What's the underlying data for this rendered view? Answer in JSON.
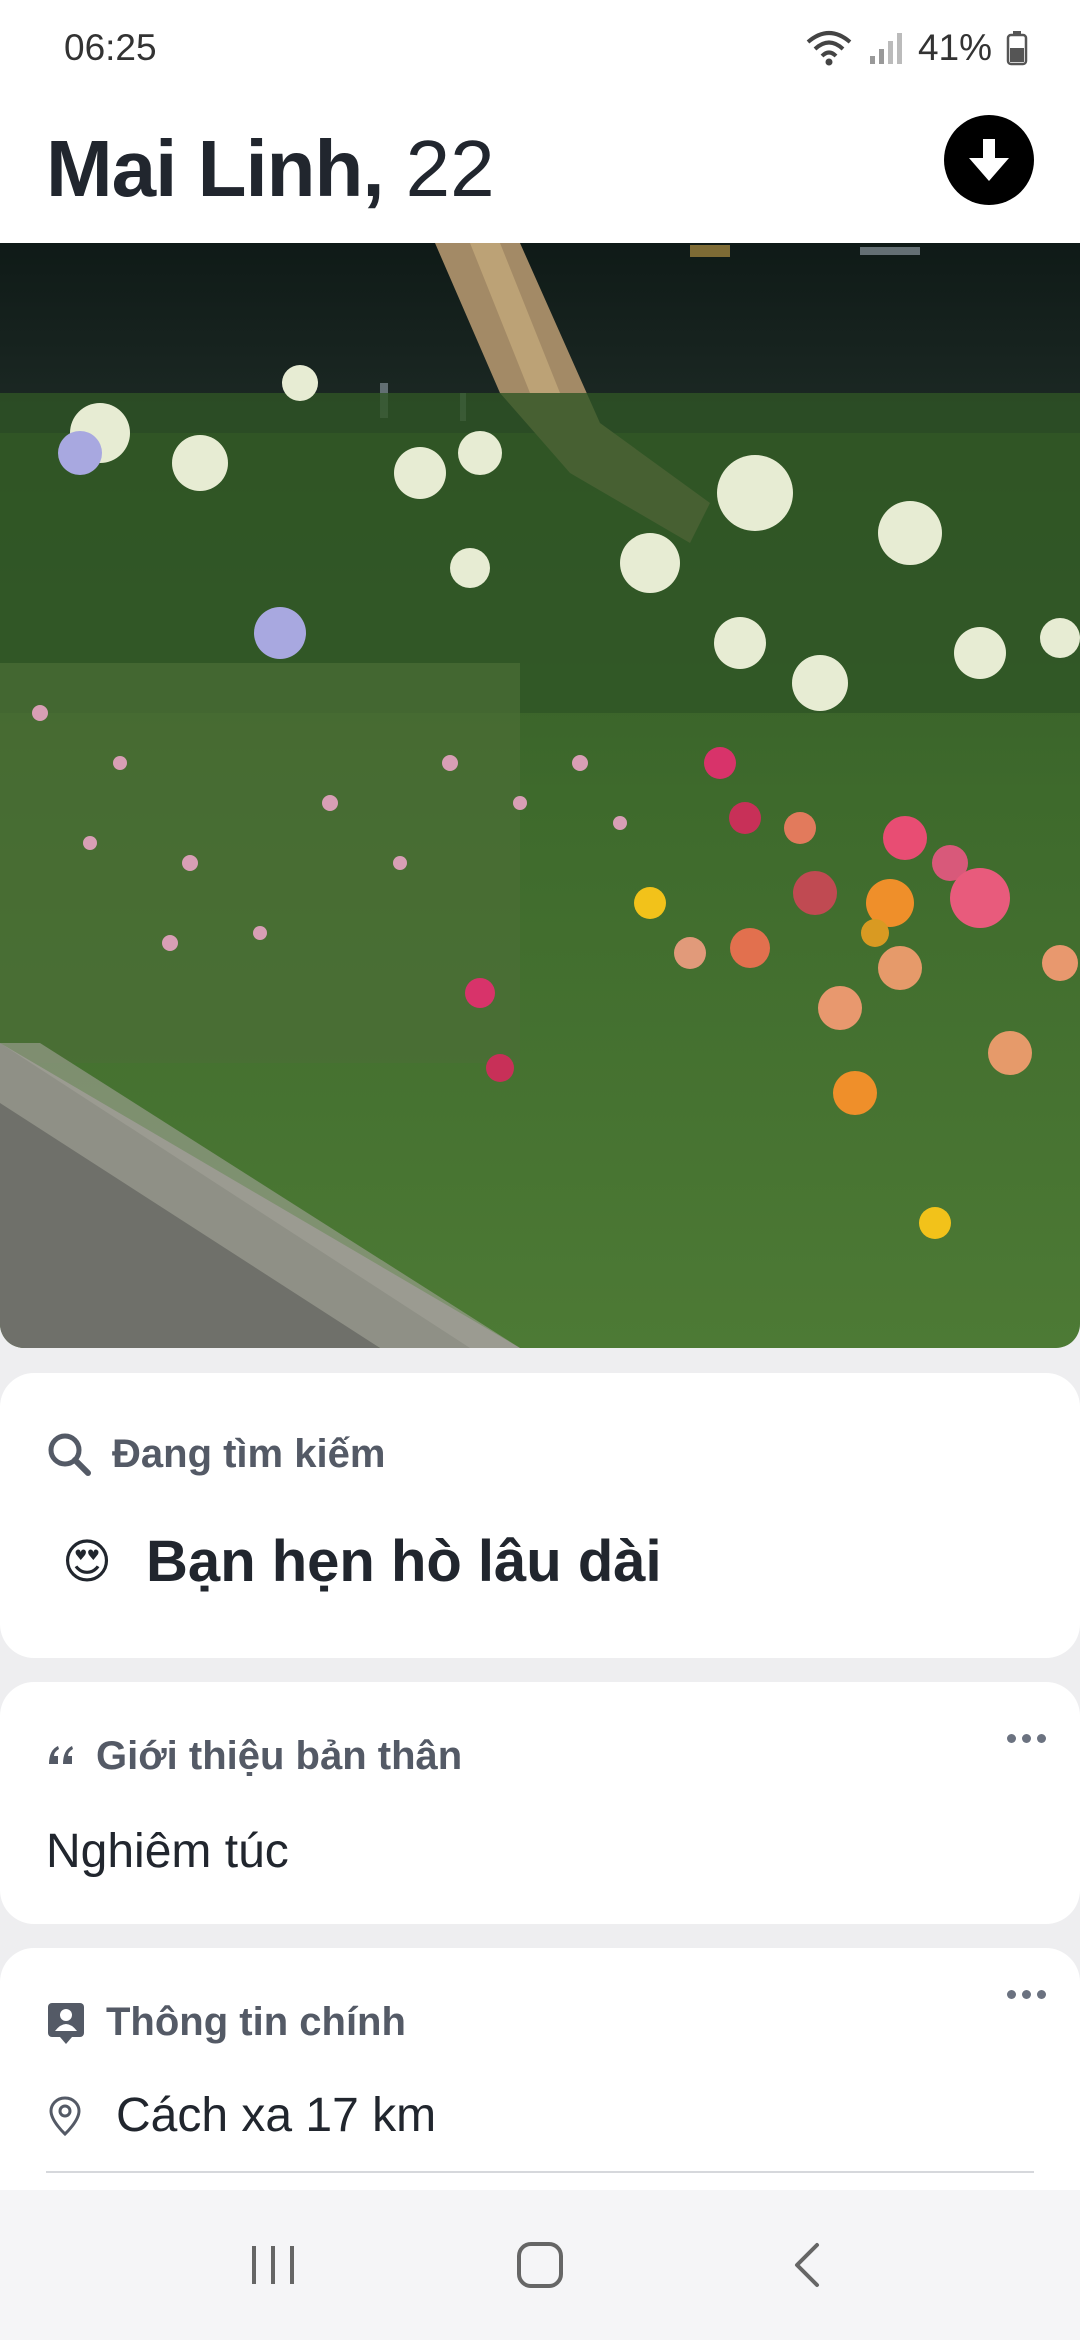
{
  "status_bar": {
    "time": "06:25",
    "battery": "41%"
  },
  "header": {
    "name": "Mai Linh,",
    "age": "22",
    "collapse_icon": "arrow-down-icon"
  },
  "photo": {
    "description_icon": "profile-photo"
  },
  "looking_for": {
    "label": "Đang tìm kiếm",
    "emoji": "😍",
    "value": "Bạn hẹn hò lâu dài"
  },
  "bio": {
    "label": "Giới thiệu bản thân",
    "text": "Nghiêm túc"
  },
  "basics": {
    "label": "Thông tin chính",
    "distance": "Cách xa 17 km"
  },
  "colors": {
    "accent": "#000000",
    "card_bg": "#ffffff",
    "page_bg": "#eeeef0",
    "label": "#545a66"
  }
}
